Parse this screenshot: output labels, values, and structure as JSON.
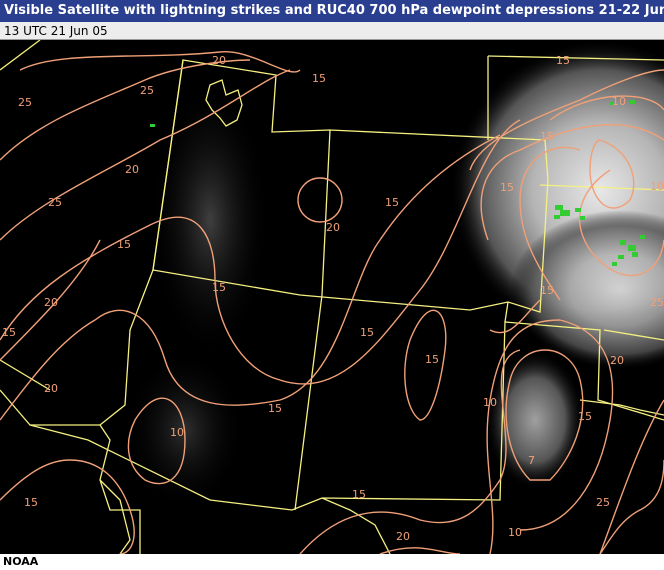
{
  "header": {
    "title": "Visible Satellite with lightning strikes and RUC40 700 hPa dewpoint depressions 21-22 Jun 05",
    "timestamp": "13 UTC 21 Jun 05"
  },
  "footer": {
    "credit": "NOAA"
  },
  "colors": {
    "contour": "#f0a078",
    "border": "#f5f080",
    "lightning": "#33cc33",
    "background": "#000000"
  },
  "contour_labels": [
    "25",
    "20",
    "15",
    "25",
    "20",
    "25",
    "15",
    "20",
    "15",
    "15",
    "15",
    "20",
    "15",
    "15",
    "20",
    "25",
    "15",
    "10",
    "15",
    "10",
    "15",
    "15",
    "10",
    "15",
    "10",
    "7",
    "15",
    "20",
    "25",
    "15",
    "10",
    "20",
    "15"
  ]
}
